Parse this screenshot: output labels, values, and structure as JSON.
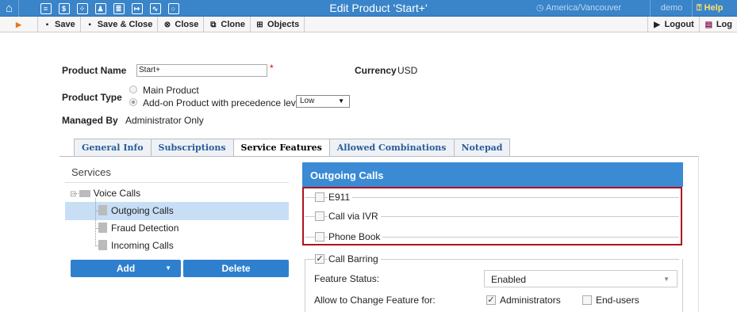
{
  "topbar": {
    "title": "Edit Product 'Start+'",
    "timezone": "America/Vancouver",
    "user": "demo",
    "help": "Help"
  },
  "toolbar": {
    "save": "Save",
    "save_close": "Save & Close",
    "close": "Close",
    "clone": "Clone",
    "objects": "Objects",
    "logout": "Logout",
    "log": "Log"
  },
  "form": {
    "product_name_label": "Product Name",
    "product_name_value": "Start+",
    "required_mark": "*",
    "currency_label": "Currency",
    "currency_value": "USD",
    "product_type_label": "Product Type",
    "type_main": "Main Product",
    "type_addon": "Add-on Product with precedence level",
    "precedence_value": "Low",
    "managed_by_label": "Managed By",
    "managed_by_value": "Administrator Only"
  },
  "tabs": [
    {
      "label": "General Info"
    },
    {
      "label": "Subscriptions"
    },
    {
      "label": "Service Features"
    },
    {
      "label": "Allowed Combinations"
    },
    {
      "label": "Notepad"
    }
  ],
  "services": {
    "header": "Services",
    "items": [
      {
        "label": "Voice Calls"
      },
      {
        "label": "Outgoing Calls"
      },
      {
        "label": "Fraud Detection"
      },
      {
        "label": "Incoming Calls"
      }
    ],
    "add_button": "Add",
    "delete_button": "Delete"
  },
  "features": {
    "header": "Outgoing Calls",
    "options": [
      {
        "label": "E911",
        "checked": false
      },
      {
        "label": "Call via IVR",
        "checked": false
      },
      {
        "label": "Phone Book",
        "checked": false
      }
    ],
    "call_barring": {
      "label": "Call Barring",
      "checked": true,
      "status_label": "Feature Status:",
      "status_value": "Enabled",
      "allow_label": "Allow to Change Feature for:",
      "administrators": "Administrators",
      "administrators_checked": true,
      "end_users": "End-users",
      "end_users_checked": false
    }
  }
}
